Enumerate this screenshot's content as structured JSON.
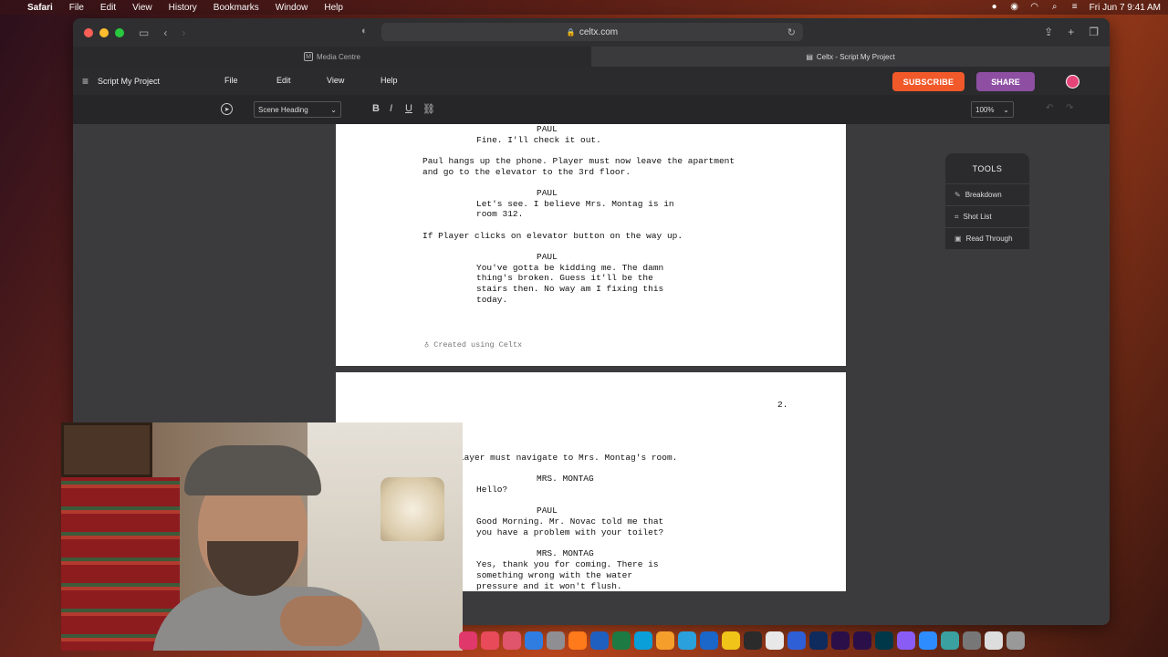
{
  "menubar": {
    "app": "Safari",
    "items": [
      "File",
      "Edit",
      "View",
      "History",
      "Bookmarks",
      "Window",
      "Help"
    ],
    "clock": "Fri Jun 7  9:41 AM"
  },
  "browser": {
    "url": "celtx.com",
    "tabs": [
      {
        "label": "Media Centre",
        "icon": "M"
      },
      {
        "label": "Celtx - Script My Project",
        "icon": "celtx-icon"
      }
    ]
  },
  "app": {
    "project": "Script My Project",
    "menus": [
      "File",
      "Edit",
      "View",
      "Help"
    ],
    "subscribe": "SUBSCRIBE",
    "share": "SHARE",
    "colors": {
      "subscribe": "#f1592a",
      "share": "#8e4fa3",
      "avatar": "#e6457a"
    }
  },
  "toolbar": {
    "element_type": "Scene Heading",
    "bold": "B",
    "italic": "I",
    "underline": "U",
    "zoom": "100%"
  },
  "page1": {
    "lines": [
      "PAUL",
      "Fine. I'll check it out.",
      "Paul hangs up the phone. Player must now leave the apartment",
      "and go to the elevator to the 3rd floor.",
      "PAUL",
      "Let's see. I believe Mrs. Montag is in",
      "room 312.",
      "If Player clicks on elevator button on the way up.",
      "PAUL",
      "You've gotta be kidding me. The damn",
      "thing's broken. Guess it'll be the",
      "stairs then. No way am I fixing this",
      "today."
    ],
    "footer": "Created using Celtx"
  },
  "page2": {
    "page_number": "2.",
    "lines": [
      "floor player must navigate to Mrs. Montag's room.",
      "MRS. MONTAG",
      "Hello?",
      "PAUL",
      "Good Morning. Mr. Novac told me that",
      "you have a problem with your toilet?",
      "MRS. MONTAG",
      "Yes, thank you for coming. There is",
      "something wrong with the water",
      "pressure and it won't flush."
    ]
  },
  "tools": {
    "title": "TOOLS",
    "items": [
      "Breakdown",
      "Shot List",
      "Read Through"
    ]
  }
}
